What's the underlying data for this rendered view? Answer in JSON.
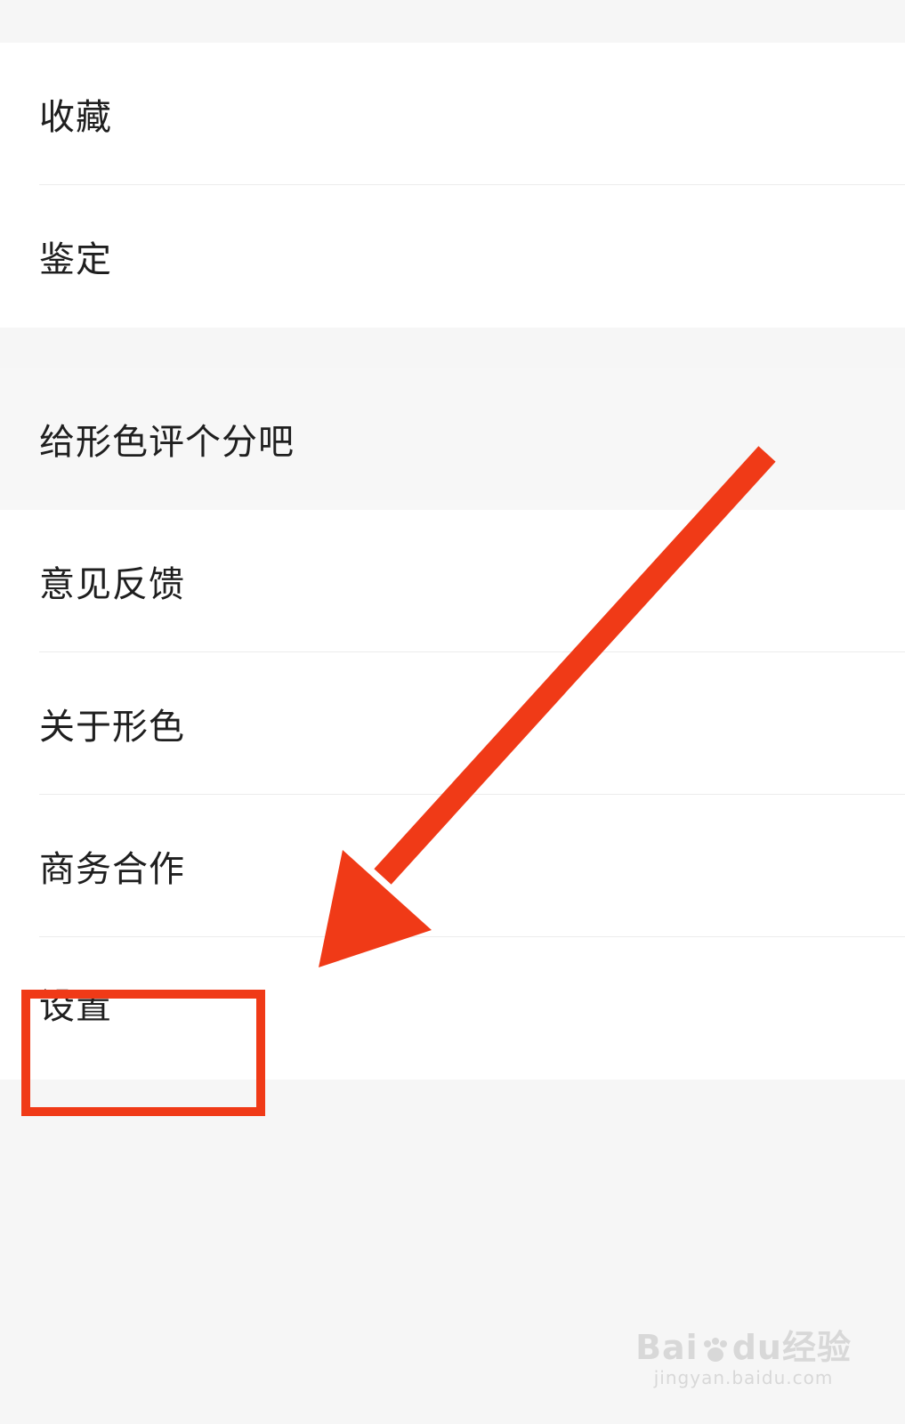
{
  "menu_group_1": {
    "items": [
      {
        "label": "收藏"
      },
      {
        "label": "鉴定"
      }
    ]
  },
  "rate_item": {
    "label": "给形色评个分吧"
  },
  "menu_group_2": {
    "items": [
      {
        "label": "意见反馈"
      },
      {
        "label": "关于形色"
      },
      {
        "label": "商务合作"
      },
      {
        "label": "设置"
      }
    ]
  },
  "annotation": {
    "arrow_color": "#f03a17",
    "highlight_color": "#f03a17",
    "highlighted_item": "设置"
  },
  "watermark": {
    "logo_left": "Bai",
    "logo_mid": "du",
    "logo_right": "经验",
    "url": "jingyan.baidu.com"
  }
}
